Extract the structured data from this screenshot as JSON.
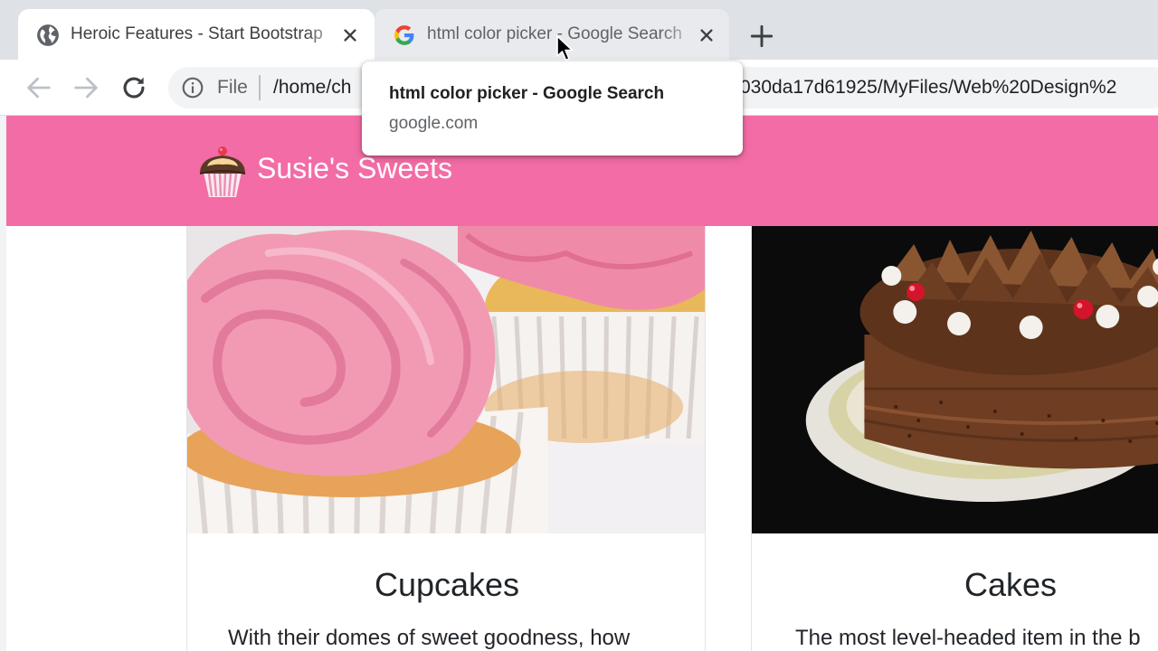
{
  "browser": {
    "tabs": [
      {
        "title": "Heroic Features - Start Bootstrap",
        "favicon": "globe-icon",
        "active": true
      },
      {
        "title": "html color picker - Google Search",
        "favicon": "google-icon",
        "active": false
      }
    ],
    "new_tab_icon": "plus-icon",
    "toolbar": {
      "back_icon": "arrow-left-icon",
      "forward_icon": "arrow-right-icon",
      "reload_icon": "reload-icon",
      "info_icon": "info-icon",
      "scheme_label": "File",
      "url_start": "/home/ch",
      "url_end": "030da17d61925/MyFiles/Web%20Design%2"
    },
    "tooltip": {
      "title": "html color picker - Google Search",
      "domain": "google.com"
    }
  },
  "page": {
    "navbar": {
      "brand": "Susie's Sweets",
      "color": "#f36ca5"
    },
    "cards": [
      {
        "title": "Cupcakes",
        "text": "With their domes of sweet goodness, how",
        "image": "cupcakes-photo"
      },
      {
        "title": "Cakes",
        "text": "The most level-headed item in the b",
        "image": "chocolate-cake-photo"
      }
    ]
  }
}
